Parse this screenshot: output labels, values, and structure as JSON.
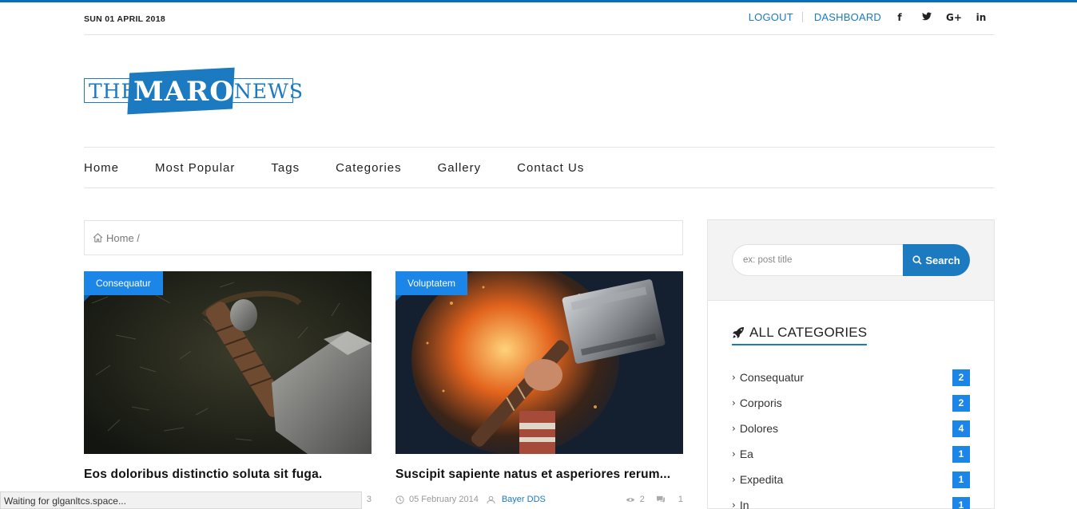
{
  "topbar": {
    "date": "SUN 01 APRIL 2018",
    "logout": "LOGOUT",
    "dashboard": "DASHBOARD",
    "social": [
      "facebook-icon",
      "twitter-icon",
      "google-plus-icon",
      "linkedin-icon"
    ],
    "social_glyphs": [
      "f",
      "t",
      "G+",
      "in"
    ]
  },
  "logo": {
    "the": "THE",
    "maro": "MARO",
    "news": "NEWS"
  },
  "nav": [
    "Home",
    "Most Popular",
    "Tags",
    "Categories",
    "Gallery",
    "Contact Us"
  ],
  "breadcrumb": {
    "home": "Home /"
  },
  "posts": [
    {
      "category": "Consequatur",
      "title": "Eos doloribus distinctio soluta sit fuga.",
      "date": "",
      "author": "",
      "views": "",
      "comments": "3"
    },
    {
      "category": "Voluptatem",
      "title": "Suscipit sapiente natus et asperiores rerum...",
      "date": "05 February 2014",
      "author": "Bayer DDS",
      "views": "2",
      "comments": "1"
    }
  ],
  "sidebar": {
    "search_placeholder": "ex: post title",
    "search_button": "Search",
    "categories_title": "ALL CATEGORIES",
    "categories": [
      {
        "name": "Consequatur",
        "count": "2"
      },
      {
        "name": "Corporis",
        "count": "2"
      },
      {
        "name": "Dolores",
        "count": "4"
      },
      {
        "name": "Ea",
        "count": "1"
      },
      {
        "name": "Expedita",
        "count": "1"
      },
      {
        "name": "In",
        "count": "1"
      }
    ]
  },
  "status_bar": "Waiting for glganltcs.space...",
  "colors": {
    "brand": "#1b7ac0",
    "badge": "#1b86e8"
  }
}
